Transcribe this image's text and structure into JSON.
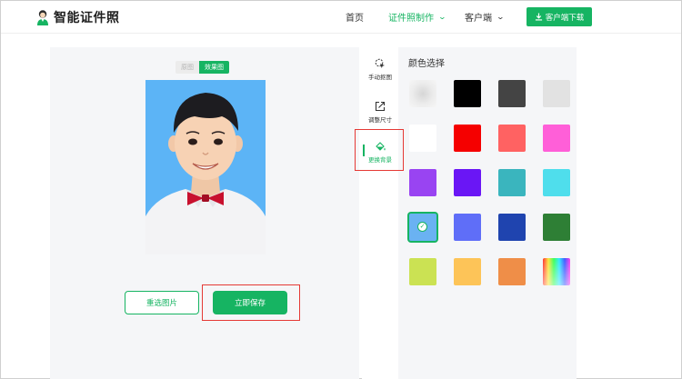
{
  "header": {
    "logo_text": "智能证件照",
    "nav": [
      {
        "label": "首页"
      },
      {
        "label": "证件照制作",
        "active": true
      },
      {
        "label": "客户端"
      }
    ],
    "download_button": "客户端下载"
  },
  "preview": {
    "toggle": {
      "original": "原图",
      "result": "效果图",
      "selected": "效果图"
    }
  },
  "actions": {
    "reselect": "重选图片",
    "save": "立即保存"
  },
  "tools": [
    {
      "label": "手动抠图",
      "icon": "cursor-target-icon"
    },
    {
      "label": "调整尺寸",
      "icon": "resize-arrow-icon"
    },
    {
      "label": "更换背景",
      "icon": "paint-bucket-icon",
      "active": true
    }
  ],
  "colors": {
    "title": "颜色选择",
    "selected_index": 12,
    "swatches": [
      {
        "name": "transparent",
        "color": "#eeeeee"
      },
      {
        "name": "black",
        "color": "#000000"
      },
      {
        "name": "dark-gray",
        "color": "#444444"
      },
      {
        "name": "light-gray",
        "color": "#e2e2e2"
      },
      {
        "name": "white",
        "color": "#ffffff"
      },
      {
        "name": "red",
        "color": "#f50000"
      },
      {
        "name": "salmon",
        "color": "#ff6262"
      },
      {
        "name": "pink",
        "color": "#ff5fd8"
      },
      {
        "name": "purple",
        "color": "#9944f2"
      },
      {
        "name": "violet",
        "color": "#6a16f5"
      },
      {
        "name": "teal",
        "color": "#3ab5be"
      },
      {
        "name": "cyan",
        "color": "#4fdeec"
      },
      {
        "name": "sky-blue",
        "color": "#6ab2f2"
      },
      {
        "name": "periwinkle",
        "color": "#5f6ef8"
      },
      {
        "name": "royal-blue",
        "color": "#1f44af"
      },
      {
        "name": "dark-green",
        "color": "#2e7f35"
      },
      {
        "name": "lime",
        "color": "#cbe253"
      },
      {
        "name": "yellow",
        "color": "#fdc458"
      },
      {
        "name": "orange",
        "color": "#ef8e48"
      },
      {
        "name": "custom-gradient",
        "color": "gradient"
      }
    ]
  }
}
